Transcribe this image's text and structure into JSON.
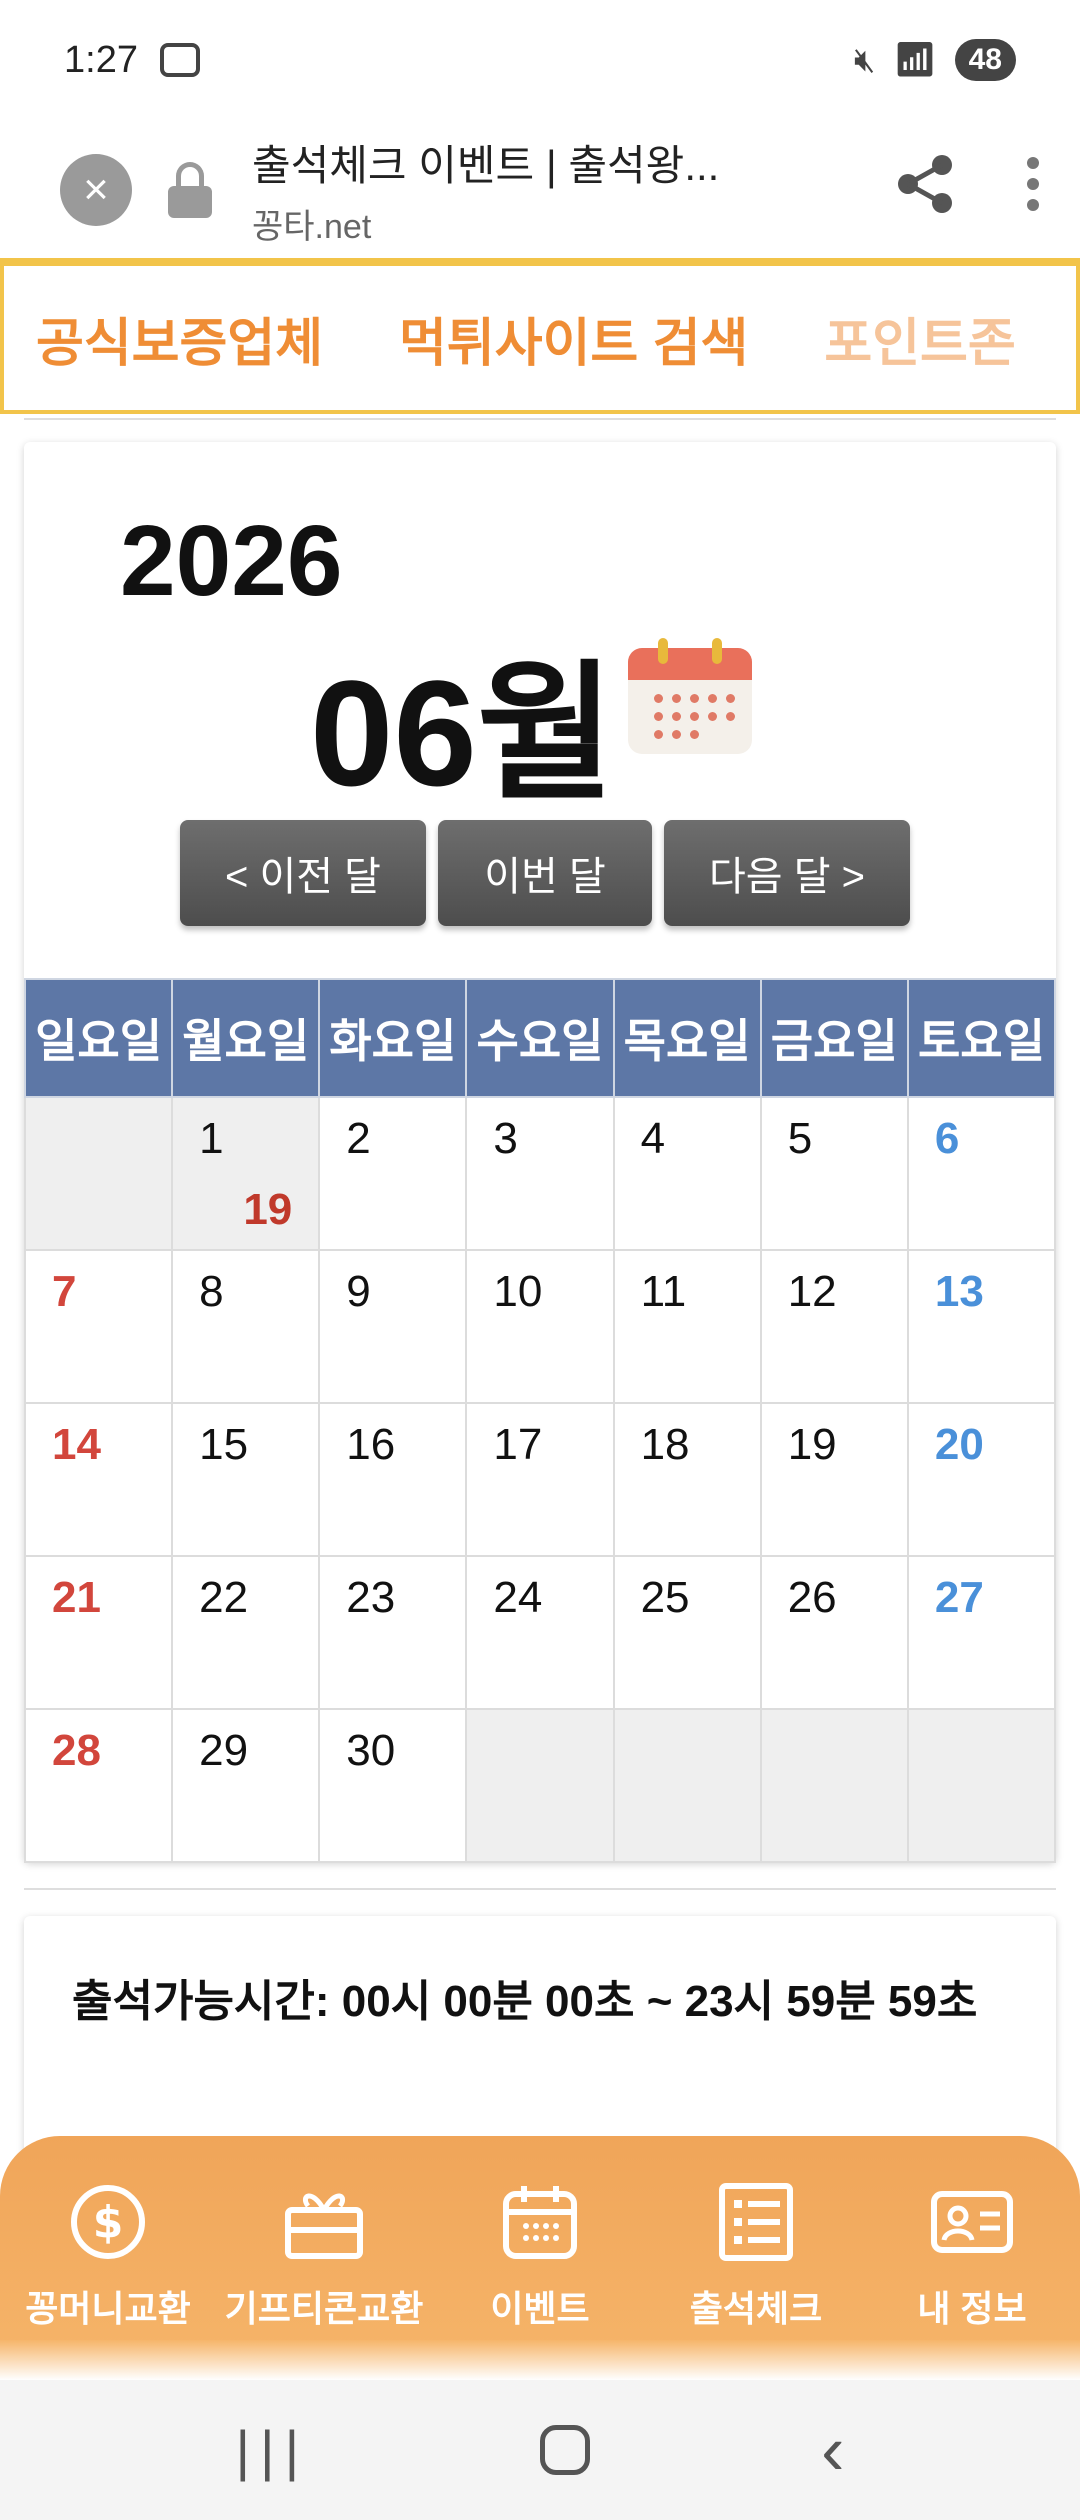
{
  "status_bar": {
    "time": "1:27",
    "battery": "48"
  },
  "browser": {
    "close_label": "×",
    "title": "출석체크 이벤트 | 출석왕...",
    "domain": "꽁타.net"
  },
  "nav_strip": {
    "items": [
      "공식보증업체",
      "먹튀사이트 검색",
      "포인트존"
    ]
  },
  "calendar": {
    "year": "2026",
    "month": "06월",
    "buttons": {
      "prev": "< 이전 달",
      "current": "이번 달",
      "next": "다음 달 >"
    },
    "weekdays": [
      "일요일",
      "월요일",
      "화요일",
      "수요일",
      "목요일",
      "금요일",
      "토요일"
    ],
    "weeks": [
      [
        "",
        "1",
        "2",
        "3",
        "4",
        "5",
        "6"
      ],
      [
        "7",
        "8",
        "9",
        "10",
        "11",
        "12",
        "13"
      ],
      [
        "14",
        "15",
        "16",
        "17",
        "18",
        "19",
        "20"
      ],
      [
        "21",
        "22",
        "23",
        "24",
        "25",
        "26",
        "27"
      ],
      [
        "28",
        "29",
        "30",
        "",
        "",
        "",
        ""
      ]
    ],
    "attendance_count": "19",
    "colors": {
      "header_bg": "#5d77a6",
      "sunday": "#d2463c",
      "saturday": "#4a90d9"
    }
  },
  "attendance": {
    "time_text": "출석가능시간: 00시 00분 00초 ~ 23시 59분 59초"
  },
  "tab_bar": {
    "items": [
      {
        "label": "꽁머니교환",
        "icon": "dollar-coin-icon"
      },
      {
        "label": "기프티콘교환",
        "icon": "gift-icon"
      },
      {
        "label": "이벤트",
        "icon": "calendar-icon"
      },
      {
        "label": "출석체크",
        "icon": "checklist-icon"
      },
      {
        "label": "내 정보",
        "icon": "id-card-icon"
      }
    ],
    "color": "#f0a559"
  }
}
